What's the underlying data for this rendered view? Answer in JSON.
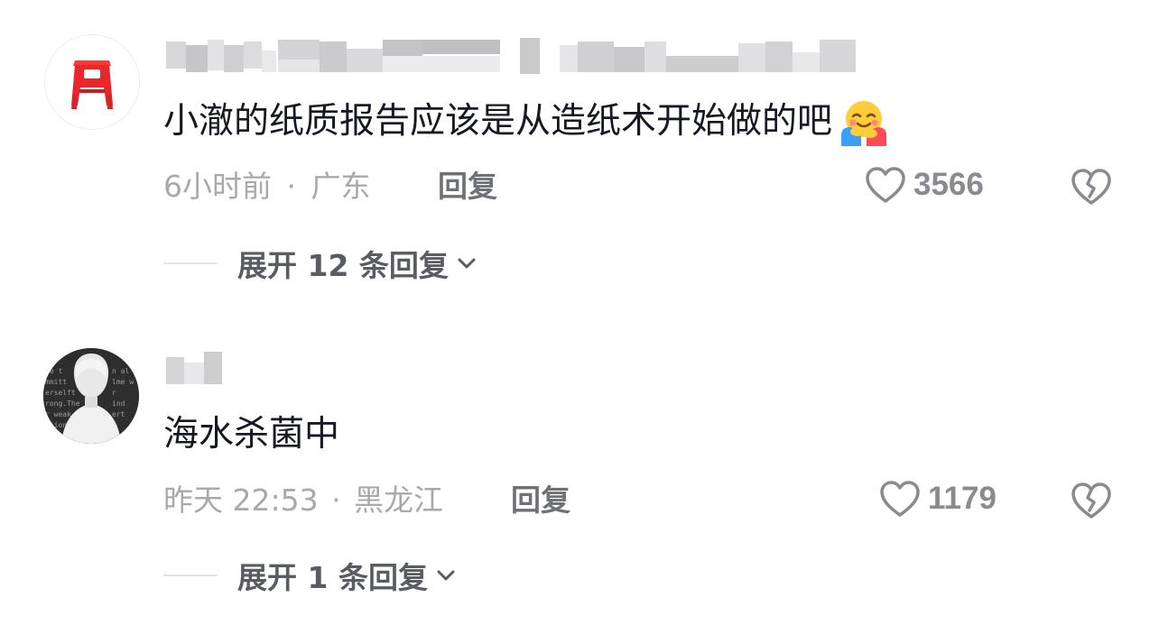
{
  "comments": [
    {
      "username": "",
      "text": "小澈的纸质报告应该是从造纸术开始做的吧",
      "emoji": "🤗",
      "time": "6小时前",
      "separator": "·",
      "location": "广东",
      "reply_label": "回复",
      "likes": "3566",
      "expand_label": "展开 12 条回复"
    },
    {
      "username": "",
      "text": "海水杀菌中",
      "time": "昨天 22:53",
      "separator": "·",
      "location": "黑龙江",
      "reply_label": "回复",
      "likes": "1179",
      "expand_label": "展开 1 条回复"
    }
  ],
  "icons": {
    "like": "heart-outline-icon",
    "dislike": "broken-heart-icon",
    "expand": "chevron-down-icon"
  },
  "colors": {
    "text_primary": "#161823",
    "text_meta": "#a8a9ad",
    "reply": "#6f7178",
    "icon": "#8a8b90",
    "stool_red": "#e8262b"
  }
}
